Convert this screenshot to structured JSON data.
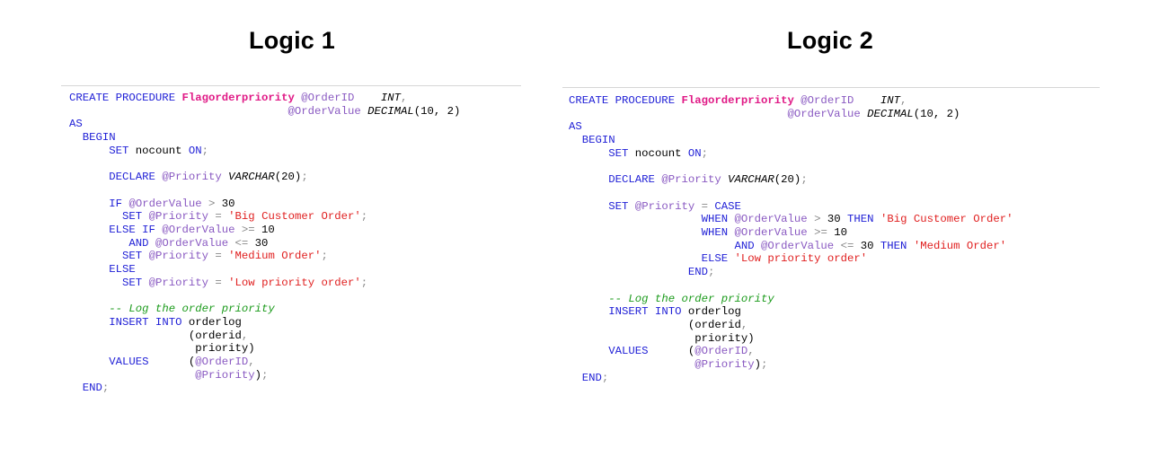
{
  "panels": [
    {
      "title": "Logic 1",
      "lines": [
        [
          [
            "kw",
            "CREATE PROCEDURE "
          ],
          [
            "fn",
            "Flagorderpriority"
          ],
          [
            "p",
            " "
          ],
          [
            "var",
            "@OrderID"
          ],
          [
            "p",
            "    "
          ],
          [
            "ty",
            "INT"
          ],
          [
            "op",
            ","
          ]
        ],
        [
          [
            "p",
            "                                 "
          ],
          [
            "var",
            "@OrderValue"
          ],
          [
            "p",
            " "
          ],
          [
            "ty",
            "DECIMAL"
          ],
          [
            "p",
            "(10, 2)"
          ]
        ],
        [
          [
            "kw",
            "AS"
          ]
        ],
        [
          [
            "p",
            "  "
          ],
          [
            "kw",
            "BEGIN"
          ]
        ],
        [
          [
            "p",
            "      "
          ],
          [
            "kw",
            "SET"
          ],
          [
            "p",
            " nocount "
          ],
          [
            "kw",
            "ON"
          ],
          [
            "op",
            ";"
          ]
        ],
        [
          [
            "p",
            ""
          ]
        ],
        [
          [
            "p",
            "      "
          ],
          [
            "kw",
            "DECLARE"
          ],
          [
            "p",
            " "
          ],
          [
            "var",
            "@Priority"
          ],
          [
            "p",
            " "
          ],
          [
            "ty",
            "VARCHAR"
          ],
          [
            "p",
            "(20)"
          ],
          [
            "op",
            ";"
          ]
        ],
        [
          [
            "p",
            ""
          ]
        ],
        [
          [
            "p",
            "      "
          ],
          [
            "kw",
            "IF"
          ],
          [
            "p",
            " "
          ],
          [
            "var",
            "@OrderValue"
          ],
          [
            "p",
            " "
          ],
          [
            "op",
            ">"
          ],
          [
            "p",
            " 30"
          ]
        ],
        [
          [
            "p",
            "        "
          ],
          [
            "kw",
            "SET"
          ],
          [
            "p",
            " "
          ],
          [
            "var",
            "@Priority"
          ],
          [
            "p",
            " "
          ],
          [
            "op",
            "="
          ],
          [
            "p",
            " "
          ],
          [
            "str",
            "'Big Customer Order'"
          ],
          [
            "op",
            ";"
          ]
        ],
        [
          [
            "p",
            "      "
          ],
          [
            "kw",
            "ELSE IF"
          ],
          [
            "p",
            " "
          ],
          [
            "var",
            "@OrderValue"
          ],
          [
            "p",
            " "
          ],
          [
            "op",
            ">="
          ],
          [
            "p",
            " 10"
          ]
        ],
        [
          [
            "p",
            "         "
          ],
          [
            "kw",
            "AND"
          ],
          [
            "p",
            " "
          ],
          [
            "var",
            "@OrderValue"
          ],
          [
            "p",
            " "
          ],
          [
            "op",
            "<="
          ],
          [
            "p",
            " 30"
          ]
        ],
        [
          [
            "p",
            "        "
          ],
          [
            "kw",
            "SET"
          ],
          [
            "p",
            " "
          ],
          [
            "var",
            "@Priority"
          ],
          [
            "p",
            " "
          ],
          [
            "op",
            "="
          ],
          [
            "p",
            " "
          ],
          [
            "str",
            "'Medium Order'"
          ],
          [
            "op",
            ";"
          ]
        ],
        [
          [
            "p",
            "      "
          ],
          [
            "kw",
            "ELSE"
          ]
        ],
        [
          [
            "p",
            "        "
          ],
          [
            "kw",
            "SET"
          ],
          [
            "p",
            " "
          ],
          [
            "var",
            "@Priority"
          ],
          [
            "p",
            " "
          ],
          [
            "op",
            "="
          ],
          [
            "p",
            " "
          ],
          [
            "str",
            "'Low priority order'"
          ],
          [
            "op",
            ";"
          ]
        ],
        [
          [
            "p",
            ""
          ]
        ],
        [
          [
            "p",
            "      "
          ],
          [
            "cm",
            "-- Log the order priority"
          ]
        ],
        [
          [
            "p",
            "      "
          ],
          [
            "kw",
            "INSERT INTO"
          ],
          [
            "p",
            " orderlog"
          ]
        ],
        [
          [
            "p",
            "                  (orderid"
          ],
          [
            "op",
            ","
          ]
        ],
        [
          [
            "p",
            "                   priority)"
          ]
        ],
        [
          [
            "p",
            "      "
          ],
          [
            "kw",
            "VALUES"
          ],
          [
            "p",
            "      ("
          ],
          [
            "var",
            "@OrderID"
          ],
          [
            "op",
            ","
          ]
        ],
        [
          [
            "p",
            "                   "
          ],
          [
            "var",
            "@Priority"
          ],
          [
            "p",
            ")"
          ],
          [
            "op",
            ";"
          ]
        ],
        [
          [
            "p",
            "  "
          ],
          [
            "kw",
            "END"
          ],
          [
            "op",
            ";"
          ]
        ]
      ]
    },
    {
      "title": "Logic 2",
      "lines": [
        [
          [
            "kw",
            "CREATE PROCEDURE "
          ],
          [
            "fn",
            "Flagorderpriority"
          ],
          [
            "p",
            " "
          ],
          [
            "var",
            "@OrderID"
          ],
          [
            "p",
            "    "
          ],
          [
            "ty",
            "INT"
          ],
          [
            "op",
            ","
          ]
        ],
        [
          [
            "p",
            "                                 "
          ],
          [
            "var",
            "@OrderValue"
          ],
          [
            "p",
            " "
          ],
          [
            "ty",
            "DECIMAL"
          ],
          [
            "p",
            "(10, 2)"
          ]
        ],
        [
          [
            "kw",
            "AS"
          ]
        ],
        [
          [
            "p",
            "  "
          ],
          [
            "kw",
            "BEGIN"
          ]
        ],
        [
          [
            "p",
            "      "
          ],
          [
            "kw",
            "SET"
          ],
          [
            "p",
            " nocount "
          ],
          [
            "kw",
            "ON"
          ],
          [
            "op",
            ";"
          ]
        ],
        [
          [
            "p",
            ""
          ]
        ],
        [
          [
            "p",
            "      "
          ],
          [
            "kw",
            "DECLARE"
          ],
          [
            "p",
            " "
          ],
          [
            "var",
            "@Priority"
          ],
          [
            "p",
            " "
          ],
          [
            "ty",
            "VARCHAR"
          ],
          [
            "p",
            "(20)"
          ],
          [
            "op",
            ";"
          ]
        ],
        [
          [
            "p",
            ""
          ]
        ],
        [
          [
            "p",
            "      "
          ],
          [
            "kw",
            "SET"
          ],
          [
            "p",
            " "
          ],
          [
            "var",
            "@Priority"
          ],
          [
            "p",
            " "
          ],
          [
            "op",
            "="
          ],
          [
            "p",
            " "
          ],
          [
            "kw",
            "CASE"
          ]
        ],
        [
          [
            "p",
            "                    "
          ],
          [
            "kw",
            "WHEN"
          ],
          [
            "p",
            " "
          ],
          [
            "var",
            "@OrderValue"
          ],
          [
            "p",
            " "
          ],
          [
            "op",
            ">"
          ],
          [
            "p",
            " 30 "
          ],
          [
            "kw",
            "THEN"
          ],
          [
            "p",
            " "
          ],
          [
            "str",
            "'Big Customer Order'"
          ]
        ],
        [
          [
            "p",
            "                    "
          ],
          [
            "kw",
            "WHEN"
          ],
          [
            "p",
            " "
          ],
          [
            "var",
            "@OrderValue"
          ],
          [
            "p",
            " "
          ],
          [
            "op",
            ">="
          ],
          [
            "p",
            " 10"
          ]
        ],
        [
          [
            "p",
            "                         "
          ],
          [
            "kw",
            "AND"
          ],
          [
            "p",
            " "
          ],
          [
            "var",
            "@OrderValue"
          ],
          [
            "p",
            " "
          ],
          [
            "op",
            "<="
          ],
          [
            "p",
            " 30 "
          ],
          [
            "kw",
            "THEN"
          ],
          [
            "p",
            " "
          ],
          [
            "str",
            "'Medium Order'"
          ]
        ],
        [
          [
            "p",
            "                    "
          ],
          [
            "kw",
            "ELSE"
          ],
          [
            "p",
            " "
          ],
          [
            "str",
            "'Low priority order'"
          ]
        ],
        [
          [
            "p",
            "                  "
          ],
          [
            "kw",
            "END"
          ],
          [
            "op",
            ";"
          ]
        ],
        [
          [
            "p",
            ""
          ]
        ],
        [
          [
            "p",
            "      "
          ],
          [
            "cm",
            "-- Log the order priority"
          ]
        ],
        [
          [
            "p",
            "      "
          ],
          [
            "kw",
            "INSERT INTO"
          ],
          [
            "p",
            " orderlog"
          ]
        ],
        [
          [
            "p",
            "                  (orderid"
          ],
          [
            "op",
            ","
          ]
        ],
        [
          [
            "p",
            "                   priority)"
          ]
        ],
        [
          [
            "p",
            "      "
          ],
          [
            "kw",
            "VALUES"
          ],
          [
            "p",
            "      ("
          ],
          [
            "var",
            "@OrderID"
          ],
          [
            "op",
            ","
          ]
        ],
        [
          [
            "p",
            "                   "
          ],
          [
            "var",
            "@Priority"
          ],
          [
            "p",
            ")"
          ],
          [
            "op",
            ";"
          ]
        ],
        [
          [
            "p",
            "  "
          ],
          [
            "kw",
            "END"
          ],
          [
            "op",
            ";"
          ]
        ]
      ]
    }
  ]
}
